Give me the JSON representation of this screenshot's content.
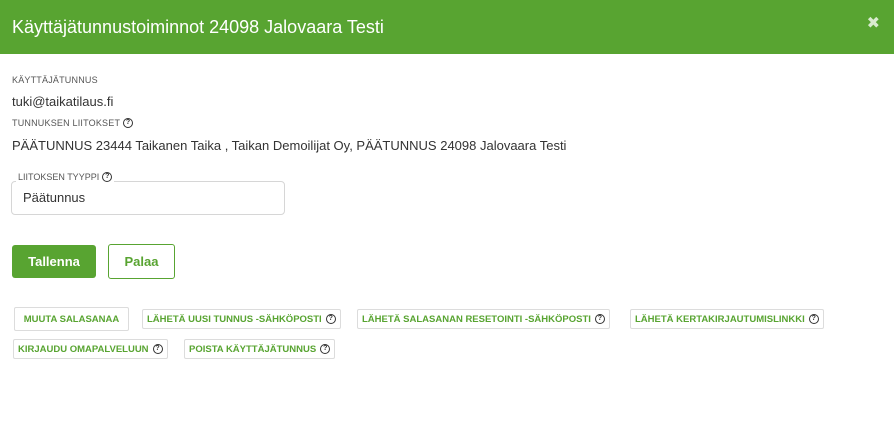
{
  "dialog": {
    "title": "Käyttäjätunnustoiminnot 24098 Jalovaara Testi",
    "close_glyph": "✖"
  },
  "user": {
    "username_label": "KÄYTTÄJÄTUNNUS",
    "username_value": "tuki@taikatilaus.fi",
    "links_label": "TUNNUKSEN LIITOKSET",
    "links_value": "PÄÄTUNNUS 23444 Taikanen Taika , Taikan Demoilijat Oy, PÄÄTUNNUS 24098 Jalovaara Testi"
  },
  "link_type": {
    "label": "LIITOKSEN TYYPPI",
    "selected": "Päätunnus"
  },
  "buttons": {
    "save": "Tallenna",
    "back": "Palaa"
  },
  "actions": {
    "change_password": "MUUTA SALASANAA",
    "send_new_account_email": "LÄHETÄ UUSI TUNNUS -SÄHKÖPOSTI",
    "send_password_reset_email": "LÄHETÄ SALASANAN RESETOINTI -SÄHKÖPOSTI",
    "send_one_time_login": "LÄHETÄ KERTAKIRJAUTUMISLINKKI",
    "login_self_service": "KIRJAUDU OMAPALVELUUN",
    "delete_account": "POISTA KÄYTTÄJÄTUNNUS"
  },
  "help_glyph": "?",
  "colors": {
    "brand_green": "#58a431"
  }
}
